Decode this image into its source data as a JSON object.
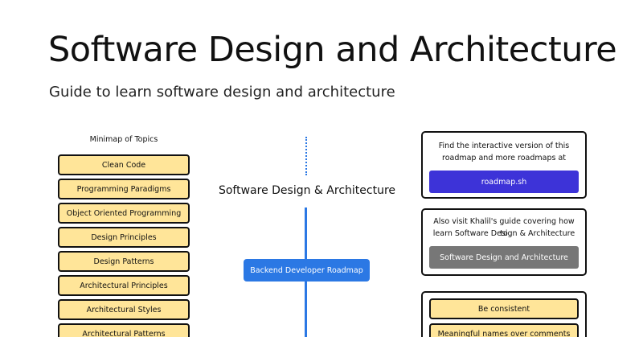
{
  "header": {
    "title": "Software Design and Architecture",
    "subtitle": "Guide to learn software design and architecture"
  },
  "minimap": {
    "heading": "Minimap of Topics",
    "items": [
      {
        "label": "Clean Code"
      },
      {
        "label": "Programming Paradigms"
      },
      {
        "label": "Object Oriented Programming"
      },
      {
        "label": "Design Principles"
      },
      {
        "label": "Design Patterns"
      },
      {
        "label": "Architectural Principles"
      },
      {
        "label": "Architectural Styles"
      },
      {
        "label": "Architectural Patterns"
      }
    ]
  },
  "roadmap": {
    "title": "Software Design & Architecture",
    "related_button": "Backend Developer Roadmap"
  },
  "info_card": {
    "line1": "Find the interactive version of this",
    "line2": "roadmap and more roadmaps at",
    "button": "roadmap.sh"
  },
  "guide_card": {
    "line1": "Also visit Khalil's guide covering how to",
    "line2": "learn Software Design & Architecture",
    "button": "Software Design and Architecture"
  },
  "tips": {
    "items": [
      {
        "label": "Be consistent"
      },
      {
        "label": "Meaningful names over comments"
      }
    ]
  },
  "colors": {
    "accent_blue": "#2b78e4",
    "roadmap_button": "#3d33d8",
    "guide_button": "#777777",
    "topic_fill": "#ffe599",
    "border": "#111111"
  }
}
